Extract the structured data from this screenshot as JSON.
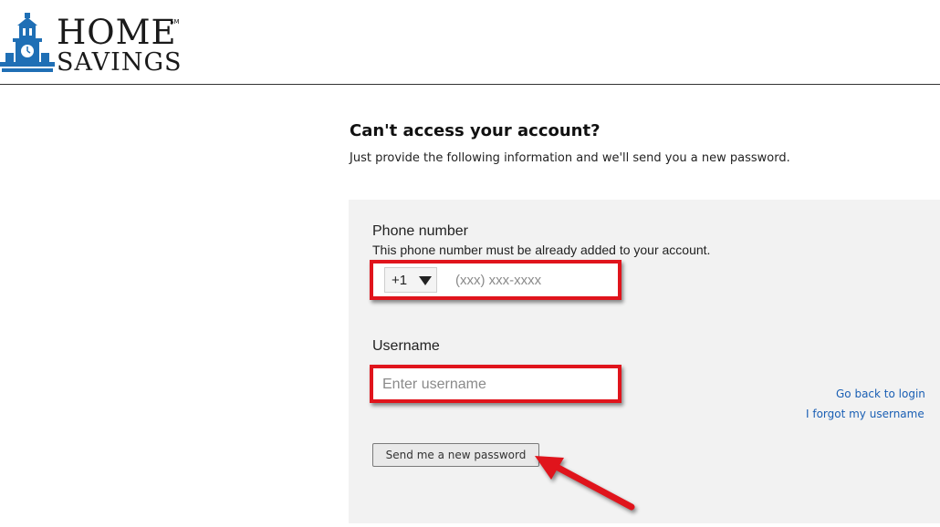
{
  "brand": {
    "line1": "HOME",
    "line2": "SAVINGS",
    "mark": "SM"
  },
  "page": {
    "title": "Can't access your account?",
    "subtitle": "Just provide the following information and we'll send you a new password."
  },
  "form": {
    "phone": {
      "label": "Phone number",
      "hint": "This phone number must be already added to your account.",
      "country_code": "+1",
      "placeholder": "(xxx) xxx-xxxx"
    },
    "username": {
      "label": "Username",
      "placeholder": "Enter username"
    },
    "submit_label": "Send me a new password"
  },
  "links": {
    "back_to_login": "Go back to login",
    "forgot_username": "I forgot my username"
  },
  "colors": {
    "highlight": "#e0141c",
    "link": "#1a5fb4",
    "panel": "#f2f2f2",
    "brand_blue": "#1f6fb5"
  },
  "icons": {
    "logo": "clock-tower-icon",
    "dropdown": "triangle-down-icon",
    "annotation": "red-arrow-icon"
  }
}
